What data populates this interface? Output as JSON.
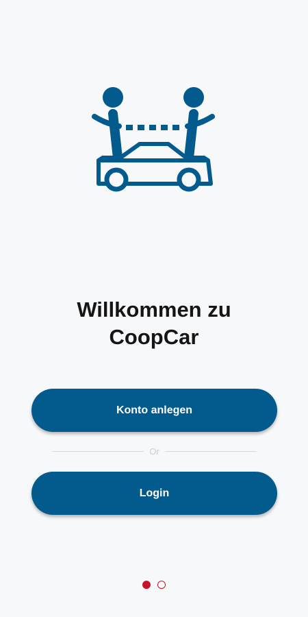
{
  "welcome": {
    "title_line1": "Willkommen zu",
    "title_line2": "CoopCar"
  },
  "actions": {
    "register_label": "Konto anlegen",
    "divider_text": "Or",
    "login_label": "Login"
  },
  "pager": {
    "total": 2,
    "active_index": 0
  },
  "colors": {
    "brand_blue": "#035a8c",
    "accent_red": "#c4132b",
    "background": "#f7f8fa"
  },
  "icons": {
    "logo": "coopcar-logo-icon"
  }
}
